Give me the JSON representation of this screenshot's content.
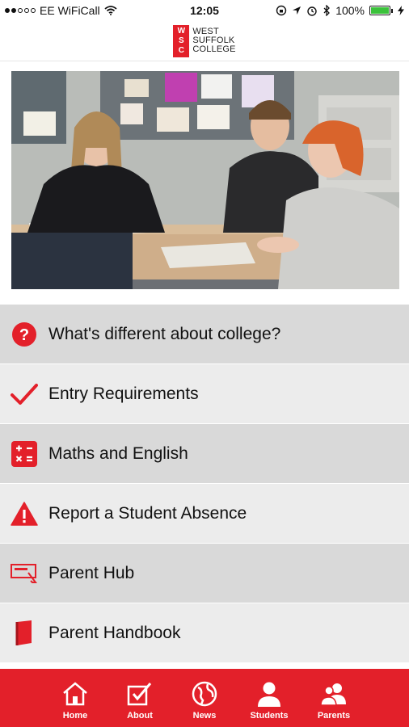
{
  "status_bar": {
    "carrier": "EE WiFiCall",
    "time": "12:05",
    "battery": "100%"
  },
  "header": {
    "logo_letters": "WSC",
    "logo_lines": [
      "WEST",
      "SUFFOLK",
      "COLLEGE"
    ]
  },
  "menu": {
    "items": [
      {
        "label": "What's different about college?",
        "icon": "question-icon"
      },
      {
        "label": "Entry Requirements",
        "icon": "checkmark-icon"
      },
      {
        "label": "Maths and English",
        "icon": "calculator-icon"
      },
      {
        "label": "Report a Student Absence",
        "icon": "warning-icon"
      },
      {
        "label": "Parent Hub",
        "icon": "presentation-icon"
      },
      {
        "label": "Parent Handbook",
        "icon": "book-icon"
      }
    ]
  },
  "tabbar": {
    "tabs": [
      {
        "label": "Home",
        "icon": "home-icon"
      },
      {
        "label": "About",
        "icon": "checkbox-icon"
      },
      {
        "label": "News",
        "icon": "globe-icon"
      },
      {
        "label": "Students",
        "icon": "person-icon"
      },
      {
        "label": "Parents",
        "icon": "people-icon"
      }
    ]
  },
  "colors": {
    "accent": "#e3202a",
    "menu_dark": "#d9d9d9",
    "menu_light": "#ececec"
  }
}
